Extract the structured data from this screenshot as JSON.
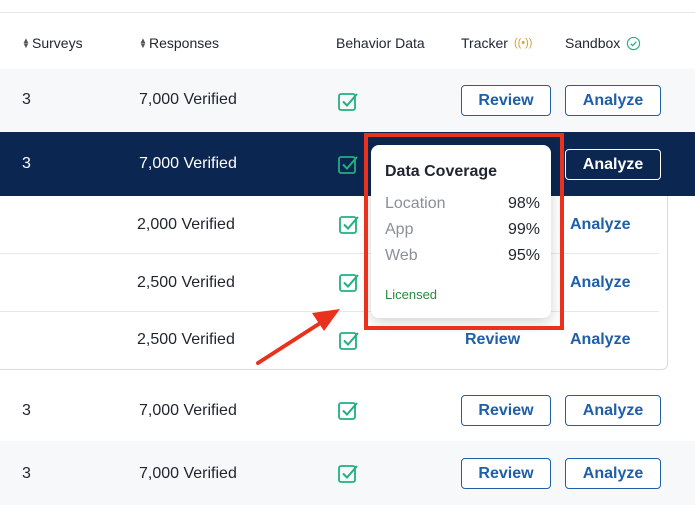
{
  "header": {
    "surveys": "Surveys",
    "responses": "Responses",
    "behavior": "Behavior Data",
    "tracker": "Tracker",
    "sandbox": "Sandbox"
  },
  "rows": [
    {
      "surveys": "3",
      "responses": "7,000 Verified",
      "review": "Review",
      "analyze": "Analyze"
    },
    {
      "surveys": "3",
      "responses": "7,000 Verified",
      "analyze": "Analyze"
    },
    {
      "responses": "2,000 Verified",
      "analyze": "Analyze"
    },
    {
      "responses": "2,500 Verified",
      "analyze": "Analyze"
    },
    {
      "responses": "2,500 Verified",
      "review": "Review",
      "analyze": "Analyze"
    },
    {
      "surveys": "3",
      "responses": "7,000 Verified",
      "review": "Review",
      "analyze": "Analyze"
    },
    {
      "surveys": "3",
      "responses": "7,000 Verified",
      "review": "Review",
      "analyze": "Analyze"
    }
  ],
  "tooltip": {
    "title": "Data Coverage",
    "items": [
      {
        "label": "Location",
        "value": "98%"
      },
      {
        "label": "App",
        "value": "99%"
      },
      {
        "label": "Web",
        "value": "95%"
      }
    ],
    "status": "Licensed"
  },
  "colors": {
    "selected_row": "#0b2650",
    "accent": "#1f5fa8",
    "check": "#22b07d",
    "annotation": "#e8321e",
    "licensed": "#2a8a3a"
  }
}
